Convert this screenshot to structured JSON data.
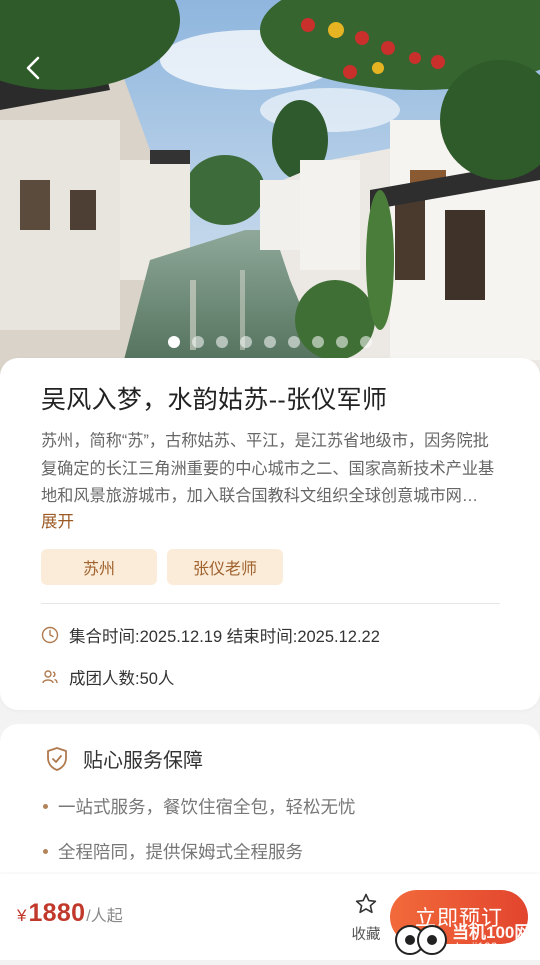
{
  "hero": {
    "carousel_count": 9,
    "carousel_active": 1
  },
  "trip": {
    "title": "吴风入梦，水韵姑苏--张仪军师",
    "description": "苏州，简称“苏”，古称姑苏、平江，是江苏省地级市，因务院批复确定的长江三角洲重要的中心城市之二、国家高新技术产业基地和风景旅游城市，加入联合国教科文组织全球创意城市网络……",
    "expand_label": "展开",
    "tags": [
      "苏州",
      "张仪老师"
    ],
    "time_text": "集合时间:2025.12.19 结束时间:2025.12.22",
    "people_text": "成团人数:50人"
  },
  "service": {
    "title": "贴心服务保障",
    "items": [
      "一站式服务，餐饮住宿全包，轻松无忧",
      "全程陪同，提供保姆式全程服务"
    ]
  },
  "bottom": {
    "price_symbol": "¥",
    "price_value": "1880",
    "price_unit": "/人起",
    "favorite_label": "收藏",
    "book_label": "立即预订"
  },
  "watermark": {
    "text": "当机100网",
    "url": "danji100.com"
  },
  "colors": {
    "accent": "#e2452e",
    "tag_bg": "#fbecd9",
    "tag_text": "#a0622e",
    "price": "#c0392b"
  },
  "icons": {
    "back": "chevron-left-icon",
    "clock": "clock-icon",
    "people": "people-icon",
    "shield": "shield-check-icon",
    "favorite": "star-icon"
  }
}
